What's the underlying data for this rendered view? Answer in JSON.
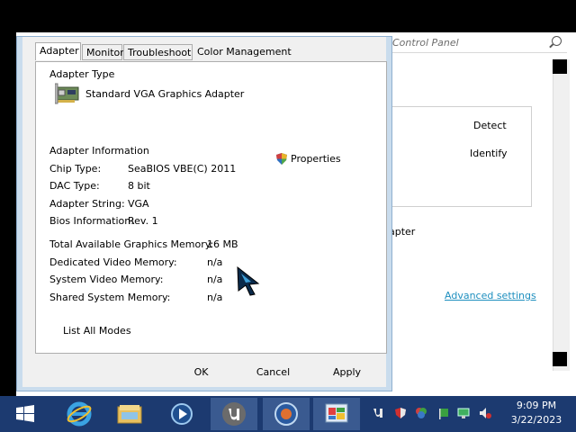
{
  "background_window": {
    "search_placeholder": "Control Panel",
    "detect_label": "Detect",
    "identify_label": "Identify",
    "adapter_partial": "apter",
    "advanced_settings_link": "Advanced settings"
  },
  "dialog": {
    "tabs": [
      {
        "label": "Adapter",
        "active": true
      },
      {
        "label": "Monitor",
        "active": false
      },
      {
        "label": "Troubleshoot",
        "active": false
      },
      {
        "label": "Color Management",
        "active": false
      }
    ],
    "adapter_type_heading": "Adapter Type",
    "adapter_name": "Standard VGA Graphics Adapter",
    "properties_label": "Properties",
    "adapter_info_heading": "Adapter Information",
    "info": [
      {
        "label": "Chip Type:",
        "value": "SeaBIOS VBE(C) 2011"
      },
      {
        "label": "DAC Type:",
        "value": "8 bit"
      },
      {
        "label": "Adapter String:",
        "value": "VGA"
      },
      {
        "label": "Bios Information:",
        "value": "Rev. 1"
      }
    ],
    "memory": [
      {
        "label": "Total Available Graphics Memory:",
        "value": "16 MB"
      },
      {
        "label": "Dedicated Video Memory:",
        "value": "n/a"
      },
      {
        "label": "System Video Memory:",
        "value": "n/a"
      },
      {
        "label": "Shared System Memory:",
        "value": "n/a"
      }
    ],
    "list_all_modes_label": "List All Modes",
    "ok_label": "OK",
    "cancel_label": "Cancel",
    "apply_label": "Apply"
  },
  "taskbar": {
    "time": "9:09 PM",
    "date": "3/22/2023",
    "items": [
      "start-icon",
      "internet-explorer-icon",
      "file-explorer-icon",
      "media-player-icon",
      "utorrent-icon",
      "network-globe-icon",
      "control-panel-icon"
    ]
  },
  "colors": {
    "taskbar": "#1c3a70",
    "dialog_frame": "#c9dced",
    "link": "#1e8fbf"
  }
}
